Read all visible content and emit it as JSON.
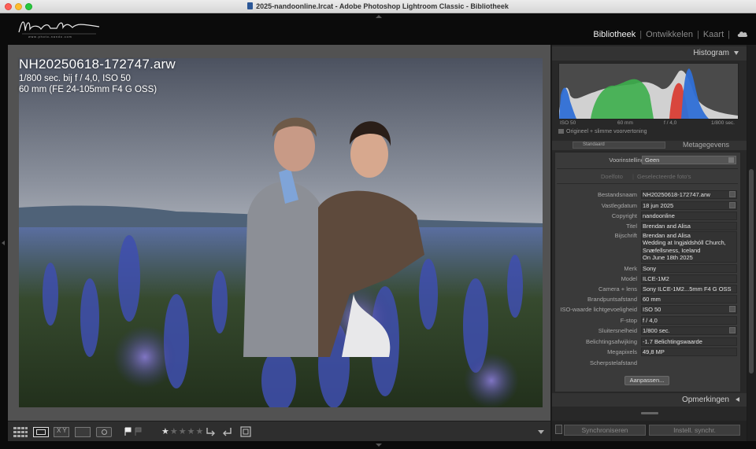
{
  "window": {
    "title": "2025-nandoonline.lrcat - Adobe Photoshop Lightroom Classic - Bibliotheek"
  },
  "identity_plate": {
    "signature": "Nando Harmsen",
    "tagline": "www.photo-nando.com"
  },
  "modules": {
    "items": [
      "Bibliotheek",
      "Ontwikkelen",
      "Kaart"
    ],
    "active": "Bibliotheek",
    "separator": "|"
  },
  "photo_info": {
    "filename": "NH20250618-172747.arw",
    "exposure_line": "1/800 sec. bij f / 4,0, ISO 50",
    "lens_line": "60 mm (FE 24-105mm F4 G OSS)"
  },
  "histogram": {
    "title": "Histogram",
    "iso": "ISO 50",
    "focal": "60 mm",
    "aperture": "f / 4,0",
    "shutter": "1/800 sec.",
    "preview_label": "Origineel + slimme voorvertoning",
    "colors": {
      "blue": "#2f6fd6",
      "green": "#3cae4b",
      "red": "#d9362c",
      "luma": "#d8d8d8"
    }
  },
  "metadata": {
    "title": "Metagegevens",
    "preset_value": "Standaard",
    "voorinstelling_label": "Voorinstelling",
    "voorinstelling_value": "Geen",
    "tabs": [
      "Doelfoto",
      "Geselecteerde foto's"
    ],
    "fields": [
      {
        "label": "Bestandsnaam",
        "value": "NH20250618-172747.arw"
      },
      {
        "label": "Vastlegdatum",
        "value": "18 jun 2025"
      },
      {
        "label": "Copyright",
        "value": "nandoonline"
      },
      {
        "label": "Titel",
        "value": "Brendan and Alisa"
      },
      {
        "label": "Bijschrift",
        "value": "Brendan and Alisa"
      },
      {
        "label": "Merk",
        "value": "Sony"
      },
      {
        "label": "Model",
        "value": "ILCE-1M2"
      },
      {
        "label": "Camera + lens",
        "value": "Sony ILCE-1M2...5mm F4 G OSS"
      },
      {
        "label": "Brandpuntsafstand",
        "value": "60 mm"
      },
      {
        "label": "ISO-waarde lichtgevoeligheid",
        "value": "ISO 50"
      },
      {
        "label": "F-stop",
        "value": "f / 4,0"
      },
      {
        "label": "Sluitersnelheid",
        "value": "1/800 sec."
      },
      {
        "label": "Belichtingsafwijking",
        "value": "-1.7 Belichtingswaarde"
      },
      {
        "label": "Megapixels",
        "value": "49,8 MP"
      },
      {
        "label": "Scherpstelafstand",
        "value": ""
      }
    ],
    "caption_lines": [
      "Wedding at Ingjaldshóll Church,",
      "Snæfellsness, Iceland",
      "On June 18th 2025"
    ],
    "customize_button": "Aanpassen..."
  },
  "comments": {
    "title": "Opmerkingen"
  },
  "sync": {
    "sync_button": "Synchroniseren",
    "settings_button": "Instell. synchr."
  },
  "toolbar": {
    "rating": 1,
    "max_rating": 5
  }
}
